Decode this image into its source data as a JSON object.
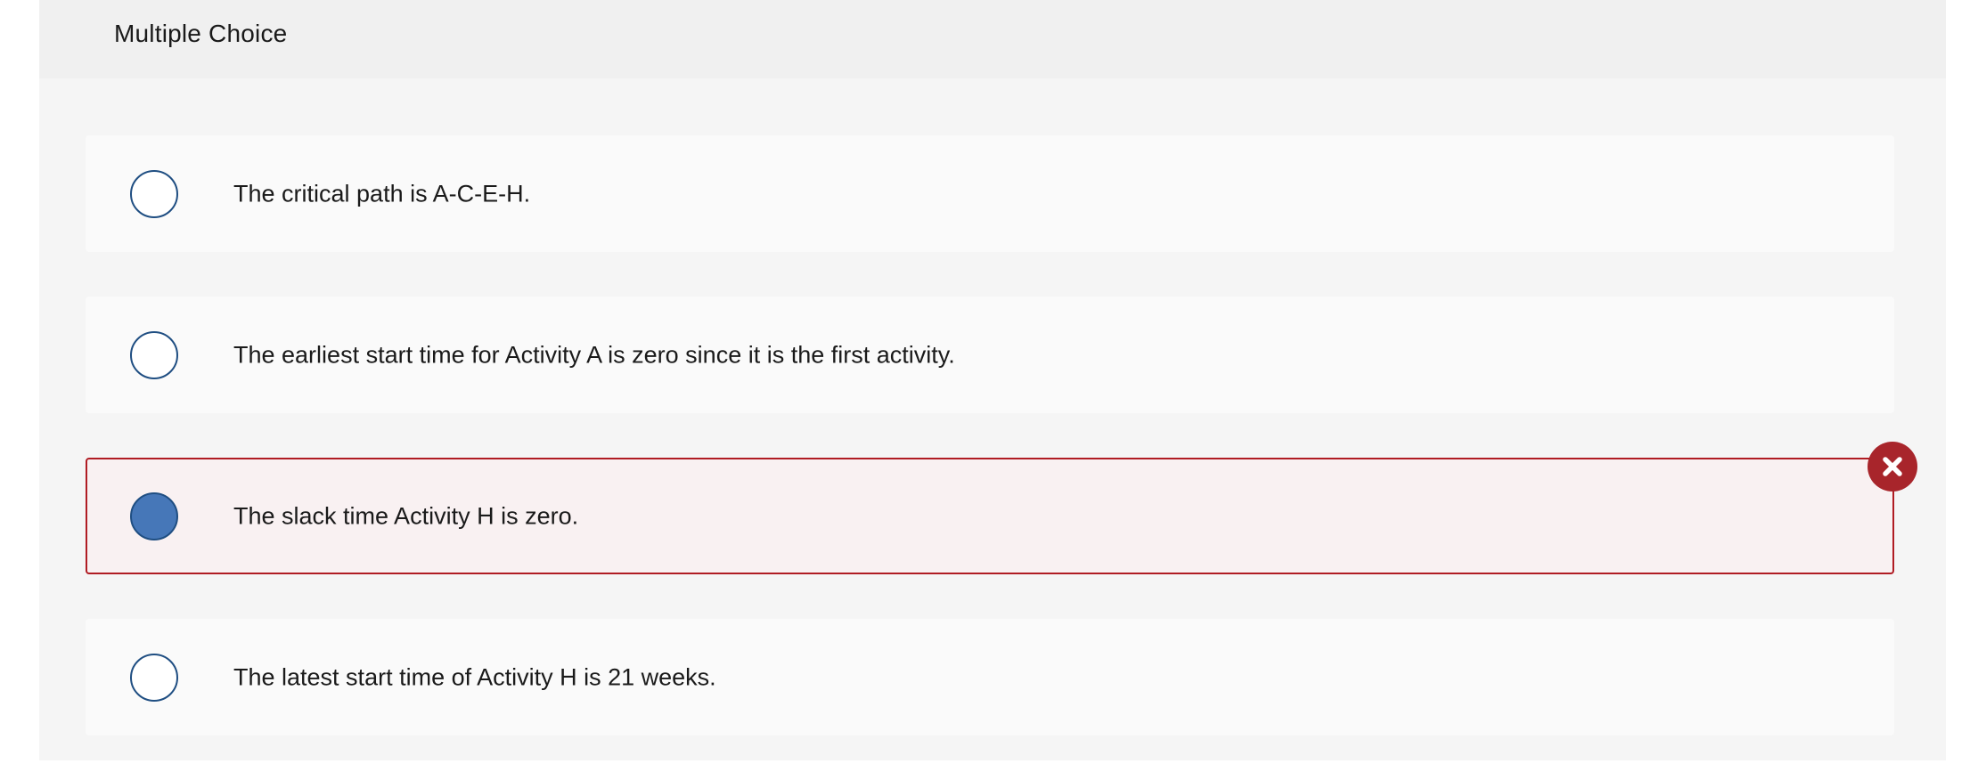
{
  "header": {
    "title": "Multiple Choice"
  },
  "choices": [
    {
      "label": "The critical path is A-C-E-H.",
      "selected": false,
      "status": ""
    },
    {
      "label": "The earliest start time for Activity A is zero since it is the first activity.",
      "selected": false,
      "status": ""
    },
    {
      "label": "The slack time Activity H is zero.",
      "selected": true,
      "status": "incorrect"
    },
    {
      "label": "The latest start time of Activity H is 21 weeks.",
      "selected": false,
      "status": ""
    }
  ],
  "icons": {
    "incorrect": "x-mark-icon"
  },
  "colors": {
    "radio_border": "#1f4e82",
    "radio_selected_fill": "#4677b8",
    "incorrect_border": "#b01c23",
    "incorrect_badge": "#a8252b",
    "incorrect_background": "#f9f1f2"
  }
}
